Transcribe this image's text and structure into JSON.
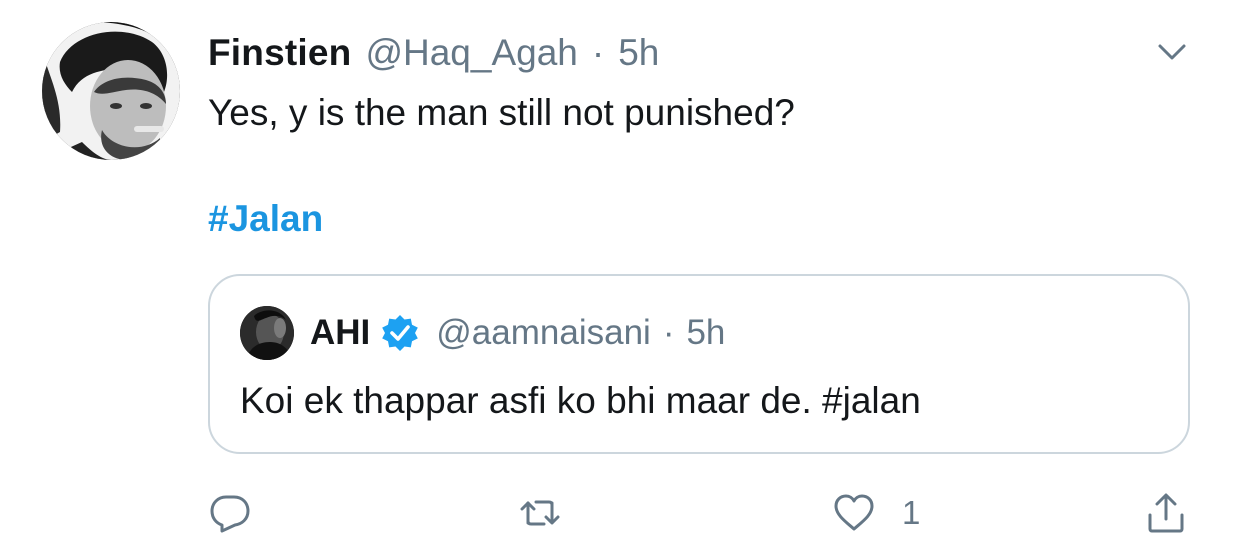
{
  "tweet": {
    "author_name": "Finstien",
    "author_handle": "@Haq_Agah",
    "separator": "·",
    "time": "5h",
    "text": "Yes, y is the man still not punished?",
    "hashtag": "#Jalan"
  },
  "quoted": {
    "author_name": "AHI",
    "verified": true,
    "author_handle": "@aamnaisani",
    "separator": "·",
    "time": "5h",
    "text": "Koi ek thappar asfi ko bhi maar de. #jalan"
  },
  "actions": {
    "like_count": "1"
  },
  "colors": {
    "link": "#1b95e0",
    "secondary_text": "#657786",
    "primary_text": "#14171a",
    "border": "#ccd6dd",
    "verified_badge": "#1da1f2"
  },
  "icons": {
    "caret": "chevron-down-icon",
    "reply": "reply-icon",
    "retweet": "retweet-icon",
    "like": "heart-icon",
    "share": "share-icon",
    "verified": "verified-badge-icon"
  }
}
